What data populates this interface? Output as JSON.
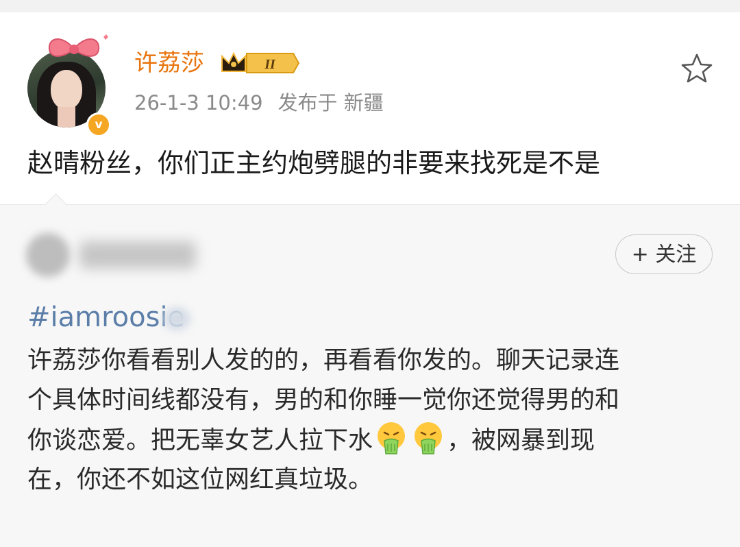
{
  "post": {
    "username": "许荔莎",
    "rank_label": "II",
    "timestamp": "26-1-3 10:49",
    "published_at_label": "发布于",
    "location": "新疆",
    "text": "赵晴粉丝，你们正主约炮劈腿的非要来找死是不是",
    "verified_badge": "v"
  },
  "repost": {
    "follow_label": "+ 关注",
    "hashtag": "#iamroosie",
    "lines": [
      "许荔莎你看看别人发的的，再看看你发的。聊天记录连",
      "个具体时间线都没有，男的和你睡一觉你还觉得男的和",
      "你谈恋爱。把无辜女艺人拉下水",
      "，被网暴到现",
      "在，你还不如这位网红真垃圾。"
    ]
  },
  "icons": {
    "star": "star-outline-icon",
    "verified": "verified-v-icon",
    "rank": "crown-rank-badge-icon",
    "emoji": "vomit-emoji-icon"
  },
  "colors": {
    "username": "#e8750f",
    "hashtag": "#5b7ea8",
    "meta": "#8a8a8a",
    "repost_bg": "#f7f7f7"
  }
}
